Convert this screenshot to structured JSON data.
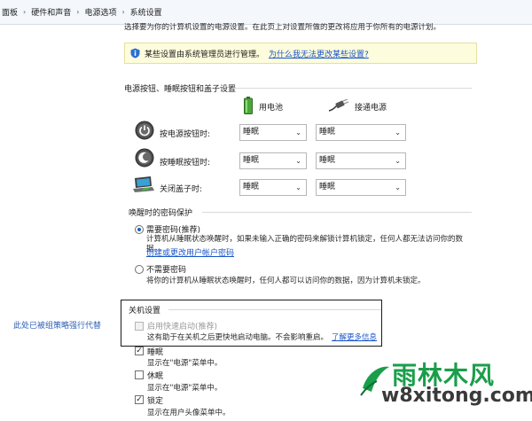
{
  "breadcrumb": {
    "items": [
      "面板",
      "硬件和声音",
      "电源选项",
      "系统设置"
    ],
    "separator": "›"
  },
  "intro_text": "选择要为你的计算机设置的电源设置。在此页上对设置所做的更改将应用于你所有的电源计划。",
  "notice": {
    "text": "某些设置由系统管理员进行管理。",
    "link": "为什么我无法更改某些设置?",
    "icon": "shield-info-icon"
  },
  "power_buttons": {
    "title": "电源按钮、睡眠按钮和盖子设置",
    "battery_label": "用电池",
    "plugged_label": "接通电源",
    "rows": [
      {
        "label": "按电源按钮时:",
        "battery": "睡眠",
        "plugged": "睡眠",
        "icon": "power-button-icon"
      },
      {
        "label": "按睡眠按钮时:",
        "battery": "睡眠",
        "plugged": "睡眠",
        "icon": "sleep-button-icon"
      },
      {
        "label": "关闭盖子时:",
        "battery": "睡眠",
        "plugged": "睡眠",
        "icon": "laptop-lid-icon"
      }
    ]
  },
  "password": {
    "title": "唤醒时的密码保护",
    "require_label": "需要密码(推荐)",
    "require_desc": "计算机从睡眠状态唤醒时，如果未输入正确的密码来解锁计算机锁定，任何人都无法访问你的数据。",
    "require_link": "创建或更改用户帐户密码",
    "norequire_label": "不需要密码",
    "norequire_desc": "将你的计算机从睡眠状态唤醒时，任何人都可以访问你的数据，因为计算机未锁定。"
  },
  "shutdown": {
    "title": "关机设置",
    "policy_note": "此处已被组策略强行代替",
    "fast_startup": {
      "label": "启用快速启动(推荐)",
      "desc": "这有助于在关机之后更快地启动电脑。不会影响重启。",
      "link": "了解更多信息",
      "checked": false
    },
    "sleep": {
      "label": "睡眠",
      "desc": "显示在\"电源\"菜单中。",
      "checked": true
    },
    "hibernate": {
      "label": "休眠",
      "desc": "显示在\"电源\"菜单中。",
      "checked": false
    },
    "lock": {
      "label": "锁定",
      "desc": "显示在用户头像菜单中。",
      "checked": true
    }
  },
  "watermark": {
    "brand": "雨林木风",
    "url": "w8xitong.com"
  }
}
